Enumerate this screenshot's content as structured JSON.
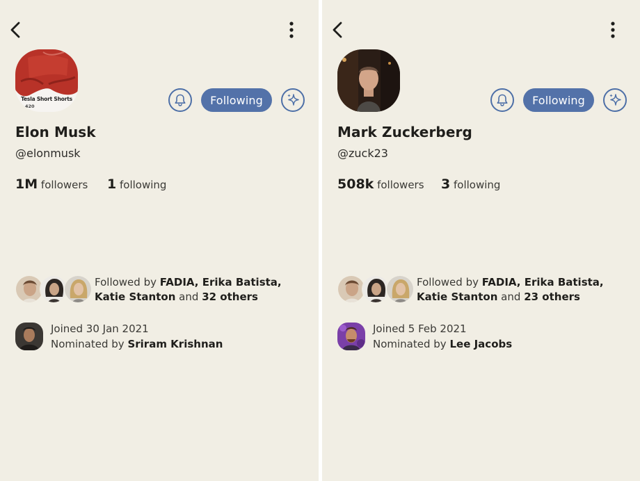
{
  "panels": [
    {
      "avatar_caption": "Tesla Short Shorts",
      "avatar_caption2": "420",
      "follow_button_label": "Following",
      "name": "Elon Musk",
      "handle": "@elonmusk",
      "followers_count": "1M",
      "followers_label": "followers",
      "following_count": "1",
      "following_label": "following",
      "followed_by_prefix": "Followed by",
      "followed_by_names": "FADIA, Erika Batista, Katie Stanton",
      "followed_by_and": "and",
      "followed_by_others": "32 others",
      "joined": "Joined 30 Jan 2021",
      "nominated_by_prefix": "Nominated by",
      "nominated_by_name": "Sriram Krishnan"
    },
    {
      "follow_button_label": "Following",
      "name": "Mark Zuckerberg",
      "handle": "@zuck23",
      "followers_count": "508k",
      "followers_label": "followers",
      "following_count": "3",
      "following_label": "following",
      "followed_by_prefix": "Followed by",
      "followed_by_names": "FADIA, Erika Batista, Katie Stanton",
      "followed_by_and": "and",
      "followed_by_others": "23 others",
      "joined": "Joined 5 Feb 2021",
      "nominated_by_prefix": "Nominated by",
      "nominated_by_name": "Lee Jacobs"
    }
  ],
  "icons": {
    "back": "chevron-left-icon",
    "more": "more-vertical-icon",
    "notify": "bell-icon",
    "options": "sparkles-icon"
  },
  "colors": {
    "background": "#f1eee4",
    "accent": "#5372a9",
    "divider": "#ffffff"
  }
}
